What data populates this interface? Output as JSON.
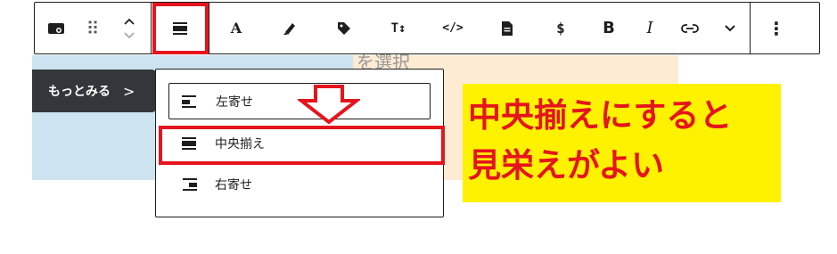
{
  "background": {
    "peach_text": "を選択",
    "more_button_label": "もっとみる",
    "more_button_chevron": ">"
  },
  "toolbar": {
    "buttons": [
      {
        "name": "block-type-icon"
      },
      {
        "name": "drag-handle-icon",
        "glyph": "⠿"
      },
      {
        "name": "move-up-down-icon"
      },
      {
        "name": "align-icon"
      },
      {
        "name": "text-color-icon",
        "glyph": "A"
      },
      {
        "name": "highlighter-icon"
      },
      {
        "name": "tag-icon"
      },
      {
        "name": "font-size-icon",
        "glyph": "T↕"
      },
      {
        "name": "code-icon",
        "glyph": "</>"
      },
      {
        "name": "document-icon"
      },
      {
        "name": "dollar-icon",
        "glyph": "$"
      },
      {
        "name": "bold-icon",
        "glyph": "B"
      },
      {
        "name": "italic-icon",
        "glyph": "I"
      },
      {
        "name": "link-icon"
      },
      {
        "name": "chevron-down-icon"
      },
      {
        "name": "more-options-icon",
        "glyph": "⋮"
      }
    ]
  },
  "dropdown": {
    "items": [
      {
        "label": "左寄せ",
        "icon": "align-left-icon"
      },
      {
        "label": "中央揃え",
        "icon": "align-center-icon"
      },
      {
        "label": "右寄せ",
        "icon": "align-right-icon"
      }
    ]
  },
  "annotation": {
    "line1": "中央揃えにすると",
    "line2": "見栄えがよい"
  },
  "colors": {
    "highlight_red": "#e5141d",
    "note_yellow": "#fff200",
    "ink": "#1e1e1e"
  }
}
